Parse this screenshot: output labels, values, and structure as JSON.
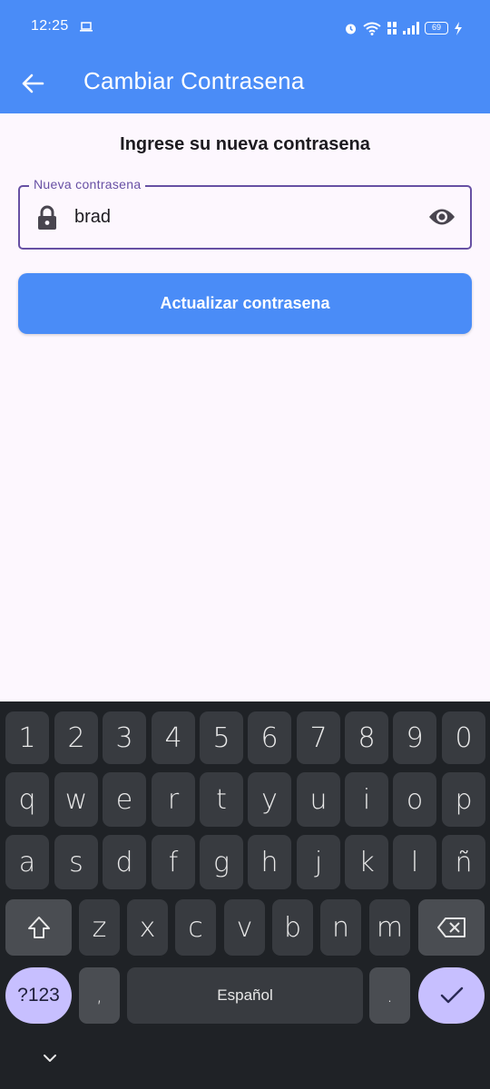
{
  "status_bar": {
    "time": "12:25",
    "battery": "69"
  },
  "app_bar": {
    "title": "Cambiar Contrasena",
    "back_icon": "arrow-back-icon"
  },
  "form": {
    "heading": "Ingrese su nueva contrasena",
    "password_field": {
      "label": "Nueva contrasena",
      "value": "brad"
    },
    "submit_label": "Actualizar contrasena"
  },
  "keyboard": {
    "row1": [
      "1",
      "2",
      "3",
      "4",
      "5",
      "6",
      "7",
      "8",
      "9",
      "0"
    ],
    "row2": [
      "q",
      "w",
      "e",
      "r",
      "t",
      "y",
      "u",
      "i",
      "o",
      "p"
    ],
    "row3": [
      "a",
      "s",
      "d",
      "f",
      "g",
      "h",
      "j",
      "k",
      "l",
      "ñ"
    ],
    "row4": [
      "z",
      "x",
      "c",
      "v",
      "b",
      "n",
      "m"
    ],
    "sym_label": "?123",
    "comma": ",",
    "space_label": "Español",
    "period": "."
  },
  "colors": {
    "primary": "#4a8cf7",
    "outline": "#6750a4",
    "background": "#fdf7fe",
    "keyboard_bg": "#1f2226",
    "key_bg": "#383b40",
    "accent_key": "#c7bfff"
  }
}
